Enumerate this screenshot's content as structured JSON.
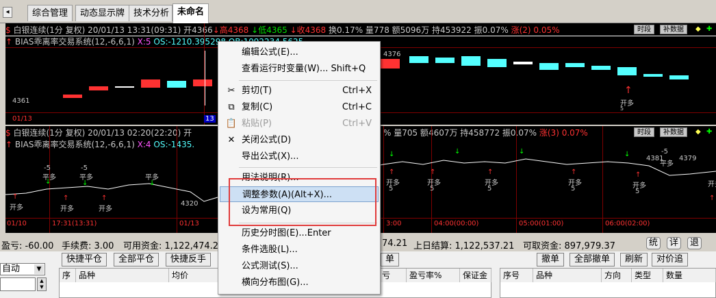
{
  "tabs": [
    "综合管理",
    "动态显示牌",
    "技术分析",
    "未命名"
  ],
  "chart1": {
    "info1": "白银连续(1分 复权) 20/01/13 13:31(09:31) 开4366",
    "info1_high": "高4368",
    "info1_low": "低4365",
    "info1_close": "收4368",
    "info1_mid": "换0.17% 量778 额5096万 持453922 振0.07%",
    "info1_up": "涨(2) 0.05%",
    "info2": "BIAS乖离率交易系统(12,-6,6,1)",
    "info2_x": "X:5",
    "info2_os": "OS:-1210.395298 OB:1092234.5625",
    "btn_period": "时段",
    "btn_data": "补数据",
    "label_low": "4361",
    "label_high": "4376",
    "date_left": "01/13",
    "date_idx": "13",
    "sig_open": "开多",
    "sig_5": "5"
  },
  "chart2": {
    "info1": "白银连续(1分 复权) 20/01/13 02:20(22:20) 开",
    "info1_right": "% 量705 额4607万 持458772 振0.07%",
    "info1_up": "涨(3) 0.07%",
    "info2": "BIAS乖离率交易系统(12,-6,6,1)",
    "info2_x": "X:4",
    "info2_os": "OS:-1435.",
    "btn_period": "时段",
    "btn_data": "补数据",
    "labels": {
      "p4320": "4320",
      "p4381": "4381",
      "p4379": "4379",
      "m5": "-5",
      "n5": "5",
      "kd": "开多",
      "pd": "平多"
    },
    "timeline": [
      "01/10",
      "17:31(13:31)",
      "01/13",
      "3:00",
      "04:00(00:00)",
      "05:00(01:00)",
      "06:00(02:00)"
    ]
  },
  "account": {
    "pl": "盈亏: -60.00",
    "fee": "手续费: 3.00",
    "avail": "可用资金: 1,122,474.21",
    "prev_settle_val": "74.21",
    "prev_settle": "上日结算: 1,122,537.21",
    "withdraw": "可取资金: 897,979.37",
    "btn_stat": "统",
    "btn_detail": "详",
    "btn_back": "退"
  },
  "order": {
    "auto": "自动",
    "buttons": [
      "快捷平仓",
      "全部平仓",
      "快捷反手"
    ],
    "single": "单",
    "right_buttons": [
      "撤单",
      "全部撤单",
      "刷新",
      "对价追"
    ],
    "left_headers": [
      "序",
      "品种",
      "均价",
      "亏",
      "盈亏率%",
      "保证金"
    ],
    "right_headers": [
      "序号",
      "品种",
      "方向",
      "类型",
      "数量"
    ]
  },
  "menu": {
    "items": [
      {
        "label": "编辑公式(E)...",
        "shortcut": "",
        "icon": ""
      },
      {
        "label": "查看运行时变量(W)... Shift+Q",
        "shortcut": "",
        "icon": ""
      },
      {
        "label": "剪切(T)",
        "shortcut": "Ctrl+X",
        "icon": "✂"
      },
      {
        "label": "复制(C)",
        "shortcut": "Ctrl+C",
        "icon": "⧉"
      },
      {
        "label": "粘贴(P)",
        "shortcut": "Ctrl+V",
        "icon": "📋"
      },
      {
        "label": "关闭公式(D)",
        "shortcut": "",
        "icon": "✕"
      },
      {
        "label": "导出公式(X)...",
        "shortcut": "",
        "icon": ""
      },
      {
        "label": "用法说明(R)...",
        "shortcut": "",
        "icon": ""
      },
      {
        "label": "调整参数(A)(Alt+X)...",
        "shortcut": "",
        "icon": ""
      },
      {
        "label": "设为常用(Q)",
        "shortcut": "",
        "icon": ""
      },
      {
        "label": "历史分时图(E)...Enter",
        "shortcut": "",
        "icon": ""
      },
      {
        "label": "条件选股(L)...",
        "shortcut": "",
        "icon": ""
      },
      {
        "label": "公式测试(S)...",
        "shortcut": "",
        "icon": ""
      },
      {
        "label": "横向分布图(G)...",
        "shortcut": "",
        "icon": ""
      }
    ]
  },
  "colors": {
    "up": "#ff3232",
    "down": "#54ffff",
    "signal_green": "#00ff00",
    "info": "#c8c8c8",
    "red_text": "#ff3232",
    "yellow": "#ffff54",
    "green_text": "#00e000",
    "dark_red": "#800000"
  }
}
